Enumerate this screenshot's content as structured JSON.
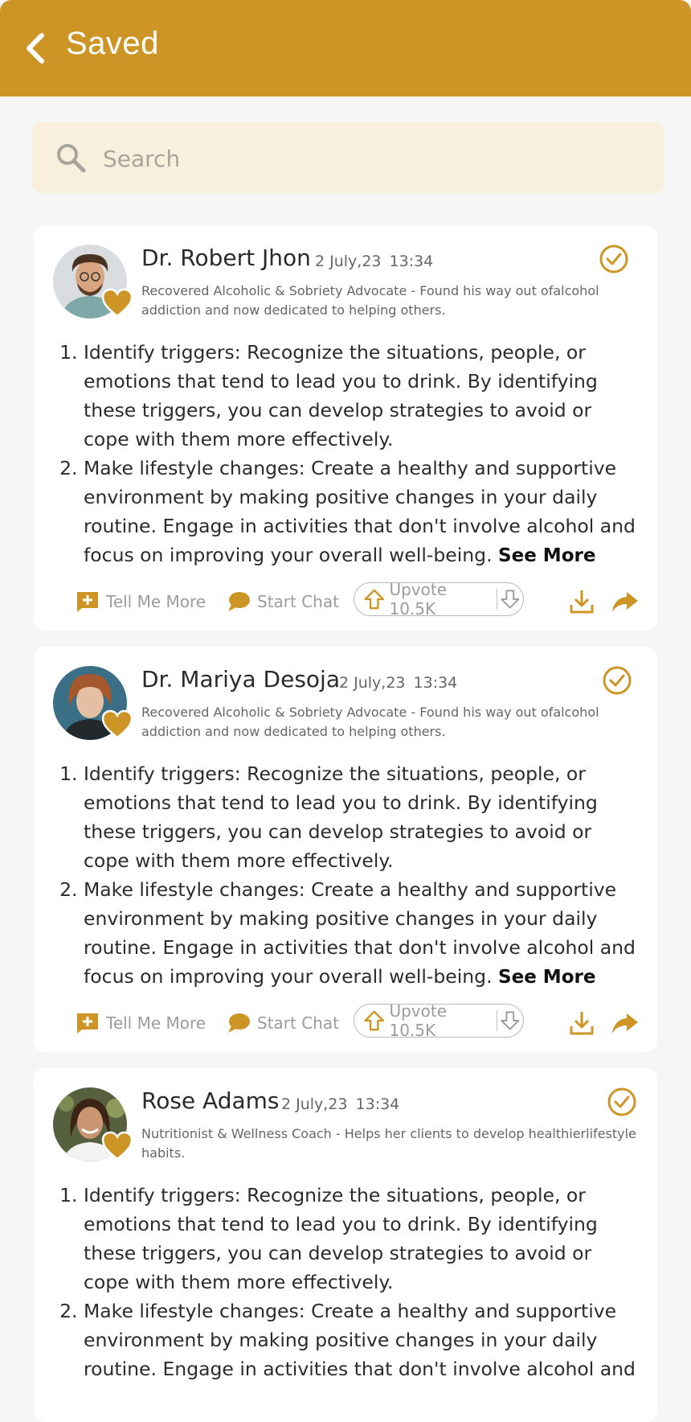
{
  "header": {
    "title": "Saved",
    "back_icon": "chevron-left-icon"
  },
  "search": {
    "placeholder": "Search",
    "value": ""
  },
  "colors": {
    "accent": "#cc9526",
    "search_bg": "#f8f0dc",
    "page_bg": "#f6f6f6"
  },
  "posts": [
    {
      "name": "Dr. Robert Jhon",
      "date": "2 July,23",
      "time": "13:34",
      "bio": "Recovered Alcoholic & Sobriety Advocate - Found his way out ofalcohol addiction and now dedicated to helping others.",
      "items": [
        "Identify triggers: Recognize the situations, people, or emotions that tend to lead you to drink. By identifying these triggers, you can develop strategies to avoid or cope with them more effectively.",
        "Make lifestyle changes: Create a healthy and supportive environment by making positive changes in your daily routine. Engage in activities that don't involve alcohol and focus on improving your overall well-being."
      ],
      "see_more": "See More",
      "actions": {
        "tell_me_more": "Tell Me More",
        "start_chat": "Start Chat",
        "upvote": "Upvote 10.5K"
      }
    },
    {
      "name": "Dr. Mariya Desoja",
      "date": "2 July,23",
      "time": "13:34",
      "bio": "Recovered Alcoholic & Sobriety Advocate - Found his way out ofalcohol addiction and now dedicated to helping others.",
      "items": [
        "Identify triggers: Recognize the situations, people, or emotions that tend to lead you to drink. By identifying these triggers, you can develop strategies to avoid or cope with them more effectively.",
        "Make lifestyle changes: Create a healthy and supportive environment by making positive changes in your daily routine. Engage in activities that don't involve alcohol and focus on improving your overall well-being."
      ],
      "see_more": "See More",
      "actions": {
        "tell_me_more": "Tell Me More",
        "start_chat": "Start Chat",
        "upvote": "Upvote 10.5K"
      }
    },
    {
      "name": "Rose Adams",
      "date": "2 July,23",
      "time": "13:34",
      "bio": "Nutritionist & Wellness Coach - Helps her clients to develop healthierlifestyle habits.",
      "items": [
        "Identify triggers: Recognize the situations, people, or emotions that tend to lead you to drink. By identifying these triggers, you can develop strategies to avoid or cope with them more effectively.",
        "Make lifestyle changes: Create a healthy and supportive environment by making positive changes in your daily routine. Engage in activities that don't involve alcohol and"
      ],
      "see_more": "",
      "actions": {
        "tell_me_more": "",
        "start_chat": "",
        "upvote": ""
      }
    }
  ]
}
